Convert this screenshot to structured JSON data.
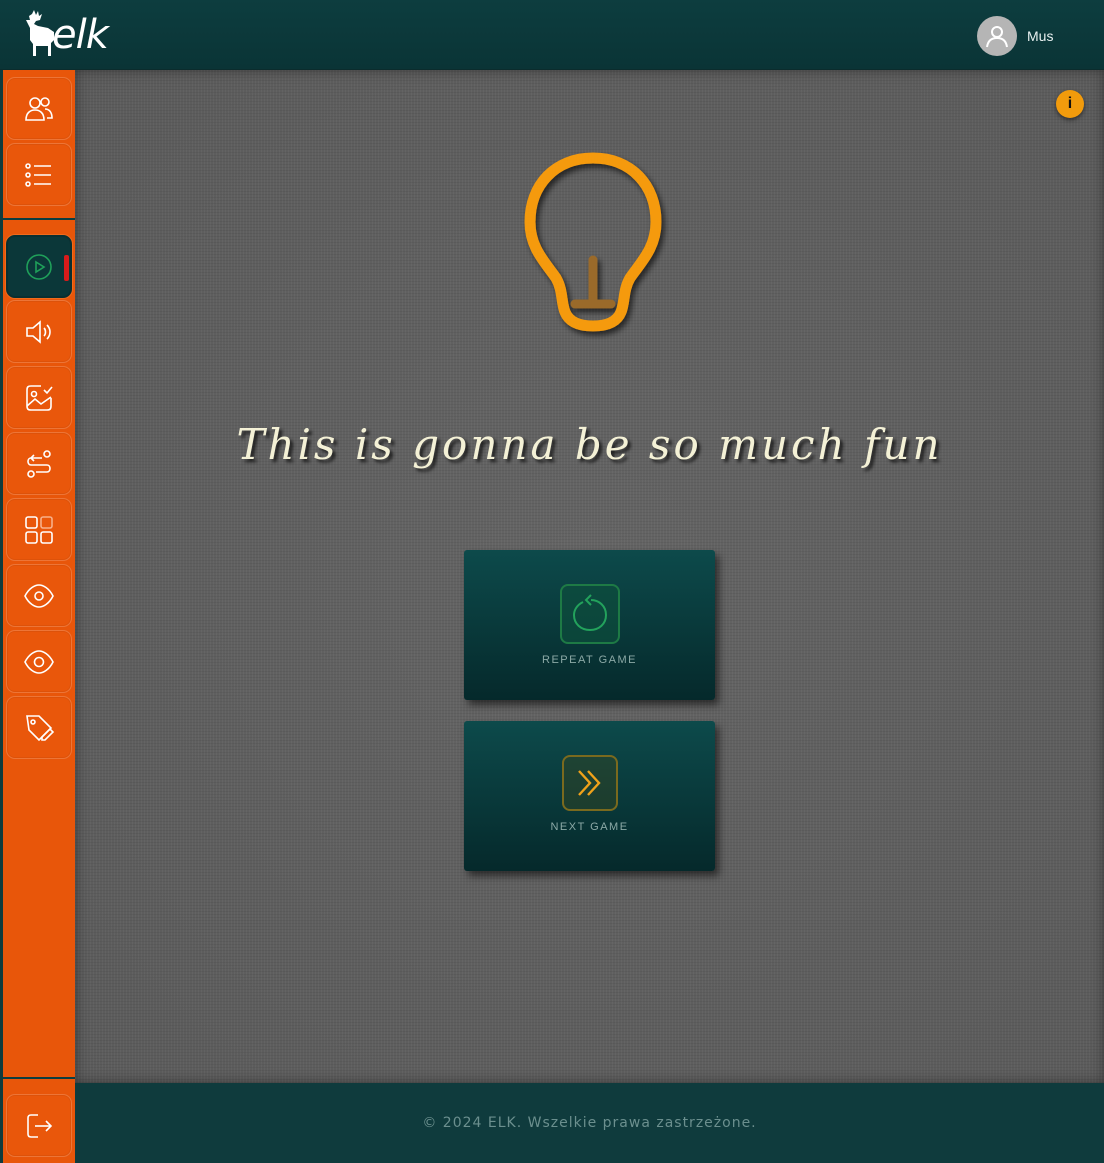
{
  "header": {
    "logo_text": "elk",
    "user_name": "Mus"
  },
  "sidebar": {
    "items": [
      {
        "name": "users-icon"
      },
      {
        "name": "list-icon"
      },
      {
        "name": "play-icon",
        "active": true
      },
      {
        "name": "speaker-icon"
      },
      {
        "name": "image-check-icon"
      },
      {
        "name": "route-icon"
      },
      {
        "name": "apps-grid-icon"
      },
      {
        "name": "eye-icon"
      },
      {
        "name": "eye-outline-icon"
      },
      {
        "name": "tag-edit-icon"
      }
    ],
    "logout": {
      "name": "logout-icon"
    }
  },
  "main": {
    "info_label": "i",
    "headline": "This is gonna be so much fun",
    "buttons": {
      "repeat_label": "REPEAT GAME",
      "next_label": "NEXT GAME"
    }
  },
  "footer": {
    "copyright": "© 2024 ELK. Wszelkie prawa zastrzeżone."
  },
  "colors": {
    "sidebar": "#e8560a",
    "header": "#0d3d3f",
    "accent": "#f29b0c",
    "active_marker": "#d81b1b"
  }
}
